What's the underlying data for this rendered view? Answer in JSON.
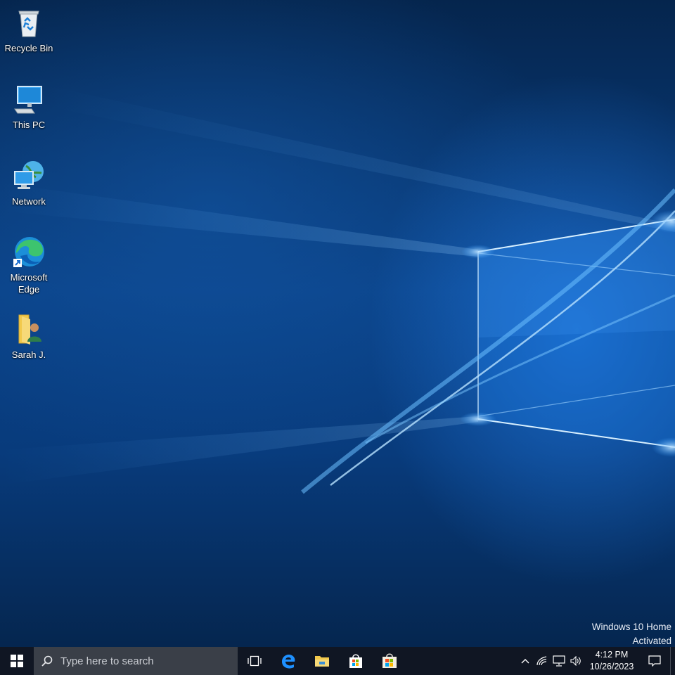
{
  "desktop": {
    "icons": [
      {
        "label": "Recycle Bin",
        "icon": "recycle-bin-icon"
      },
      {
        "label": "This PC",
        "icon": "computer-icon"
      },
      {
        "label": "Network",
        "icon": "network-icon"
      },
      {
        "label": "Microsoft Edge",
        "icon": "edge-icon"
      },
      {
        "label": "Sarah J.",
        "icon": "user-folder-icon"
      }
    ]
  },
  "watermark": {
    "line1": "Windows 10 Home",
    "line2": "Activated"
  },
  "taskbar": {
    "search_placeholder": "Type here to search",
    "pinned": [
      "task-view-icon",
      "edge-icon",
      "file-explorer-icon",
      "store-icon",
      "store-bag-icon"
    ],
    "tray": [
      "chevron-up-icon",
      "wifi-icon",
      "network-icon",
      "volume-icon"
    ],
    "time": "4:12 PM",
    "date": "10/26/2023"
  },
  "colors": {
    "taskbar": "#101623",
    "search_box": "#3a3f48",
    "accent": "#0078d7"
  }
}
